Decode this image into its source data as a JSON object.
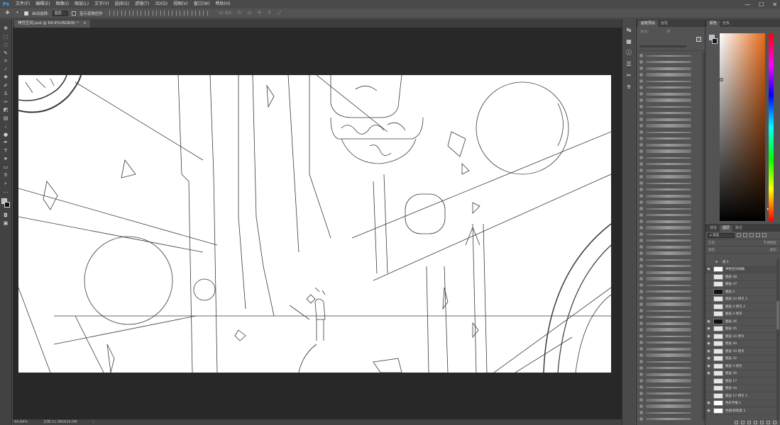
{
  "app": {
    "logo": "Ps",
    "menus": [
      "文件(F)",
      "编辑(E)",
      "图像(I)",
      "图层(L)",
      "文字(Y)",
      "选择(S)",
      "滤镜(T)",
      "3D(D)",
      "视图(V)",
      "窗口(W)",
      "帮助(H)"
    ],
    "window_controls": [
      "—",
      "☐",
      "✕"
    ]
  },
  "options_bar": {
    "auto_select_label": "自动选择:",
    "auto_select_value": "图层",
    "transform_label": "显示变换控件",
    "mode_3d_label": "3D 模式:"
  },
  "document": {
    "tab_title": "神性空间.psd @ 64.8%(RGB/8) *",
    "tab_close": "×"
  },
  "status": {
    "zoom": "64.84%",
    "doc_size": "文档:11.0M/419.0M",
    "arrow": "›"
  },
  "tools": [
    "move",
    "marquee",
    "lasso",
    "quick-select",
    "crop",
    "eyedropper",
    "healing",
    "brush",
    "stamp",
    "history-brush",
    "eraser",
    "gradient",
    "blur",
    "dodge",
    "pen",
    "type",
    "path-select",
    "shape",
    "hand",
    "zoom",
    "more"
  ],
  "brush_panel": {
    "tabs": [
      "画笔预设",
      "画笔"
    ],
    "size_label": "大小:"
  },
  "color_panel": {
    "tabs": [
      "颜色",
      "色板"
    ],
    "fg_color": "#bdbdbd",
    "bg_color": "#0e1a2b",
    "hue_color": "#e66a1a"
  },
  "layers_panel": {
    "tabs": [
      "通道",
      "图层",
      "路径"
    ],
    "filter_label": "ρ 类型",
    "blend_mode": "正常",
    "opacity_label": "不透明度:",
    "lock_label": "锁定:",
    "fill_label": "填充:",
    "layers": [
      {
        "name": "组 2",
        "visible": false,
        "thumb": "folder"
      },
      {
        "name": "神性空间线稿",
        "visible": true,
        "thumb": "white"
      },
      {
        "name": "图层 48",
        "visible": false,
        "thumb": "checker"
      },
      {
        "name": "图层 47",
        "visible": false,
        "thumb": "checker"
      },
      {
        "name": "图层 3",
        "visible": false,
        "thumb": "dark"
      },
      {
        "name": "图层 24 拷贝 3",
        "visible": false,
        "thumb": "checker"
      },
      {
        "name": "图层 4 拷贝 2",
        "visible": false,
        "thumb": "checker"
      },
      {
        "name": "图层 4 拷贝",
        "visible": false,
        "thumb": "checker"
      },
      {
        "name": "图层 46",
        "visible": true,
        "thumb": "dark"
      },
      {
        "name": "图层 45",
        "visible": true,
        "thumb": "checker"
      },
      {
        "name": "图层 24 拷贝",
        "visible": true,
        "thumb": "checker"
      },
      {
        "name": "图层 40",
        "visible": true,
        "thumb": "checker"
      },
      {
        "name": "图层 44 拷贝",
        "visible": true,
        "thumb": "checker"
      },
      {
        "name": "图层 32",
        "visible": true,
        "thumb": "checker"
      },
      {
        "name": "图层 4 拷贝",
        "visible": true,
        "thumb": "checker"
      },
      {
        "name": "图层 26",
        "visible": true,
        "thumb": "checker"
      },
      {
        "name": "图层 17",
        "visible": false,
        "thumb": "checker"
      },
      {
        "name": "图层 44",
        "visible": false,
        "thumb": "checker"
      },
      {
        "name": "图层 17 拷贝 2",
        "visible": false,
        "thumb": "checker"
      },
      {
        "name": "色彩平衡 1",
        "visible": true,
        "thumb": "white"
      },
      {
        "name": "色相/饱和度 1",
        "visible": true,
        "thumb": "white"
      }
    ]
  },
  "icon_strip": [
    "history-icon",
    "properties-icon",
    "info-icon",
    "adjust-icon",
    "tools-icon",
    "brush-settings-icon"
  ]
}
